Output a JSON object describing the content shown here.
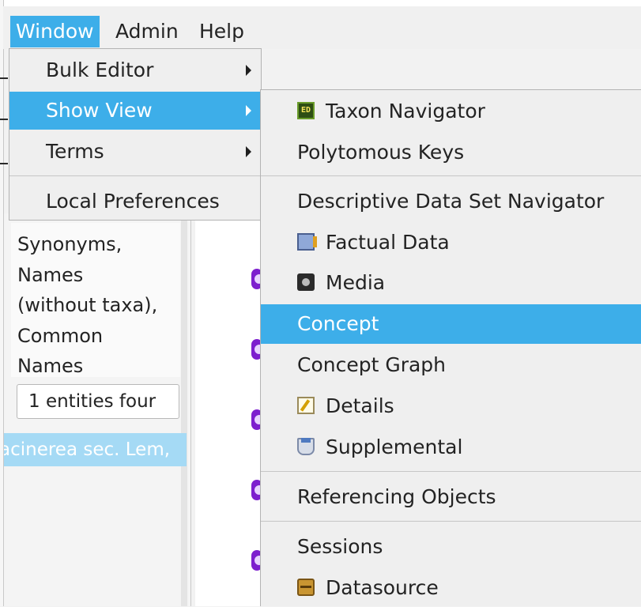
{
  "menubar": {
    "items": [
      "Window",
      "Admin",
      "Help"
    ],
    "active": "Window"
  },
  "window_menu": {
    "items": [
      {
        "label": "Bulk Editor",
        "submenu": true
      },
      {
        "label": "Show View",
        "submenu": true,
        "active": true
      },
      {
        "label": "Terms",
        "submenu": true
      },
      {
        "label": "Local Preferences",
        "submenu": false
      }
    ]
  },
  "show_view_menu": {
    "items": [
      {
        "label": "Taxon Navigator",
        "icon": "taxon-navigator-icon",
        "icon_text": "ED"
      },
      {
        "label": "Polytomous Keys"
      },
      {
        "label": "Descriptive Data Set Navigator"
      },
      {
        "label": "Factual Data",
        "icon": "factual-data-icon"
      },
      {
        "label": "Media",
        "icon": "camera-icon"
      },
      {
        "label": "Concept",
        "active": true
      },
      {
        "label": "Concept Graph"
      },
      {
        "label": "Details",
        "icon": "details-icon"
      },
      {
        "label": "Supplemental",
        "icon": "supplemental-icon"
      },
      {
        "label": "Referencing Objects"
      },
      {
        "label": "Sessions"
      },
      {
        "label": "Datasource",
        "icon": "datasource-icon"
      }
    ]
  },
  "background": {
    "search_scope_text": "Synonyms,\nNames\n(without taxa),\nCommon\nNames",
    "result_count": "1 entities four",
    "selected_result": "acinerea sec. Lem,"
  },
  "colors": {
    "accent": "#3daee9",
    "menu_bg": "#efefef",
    "selection_light": "#a5daf5",
    "node_icon": "#7d1fce"
  }
}
